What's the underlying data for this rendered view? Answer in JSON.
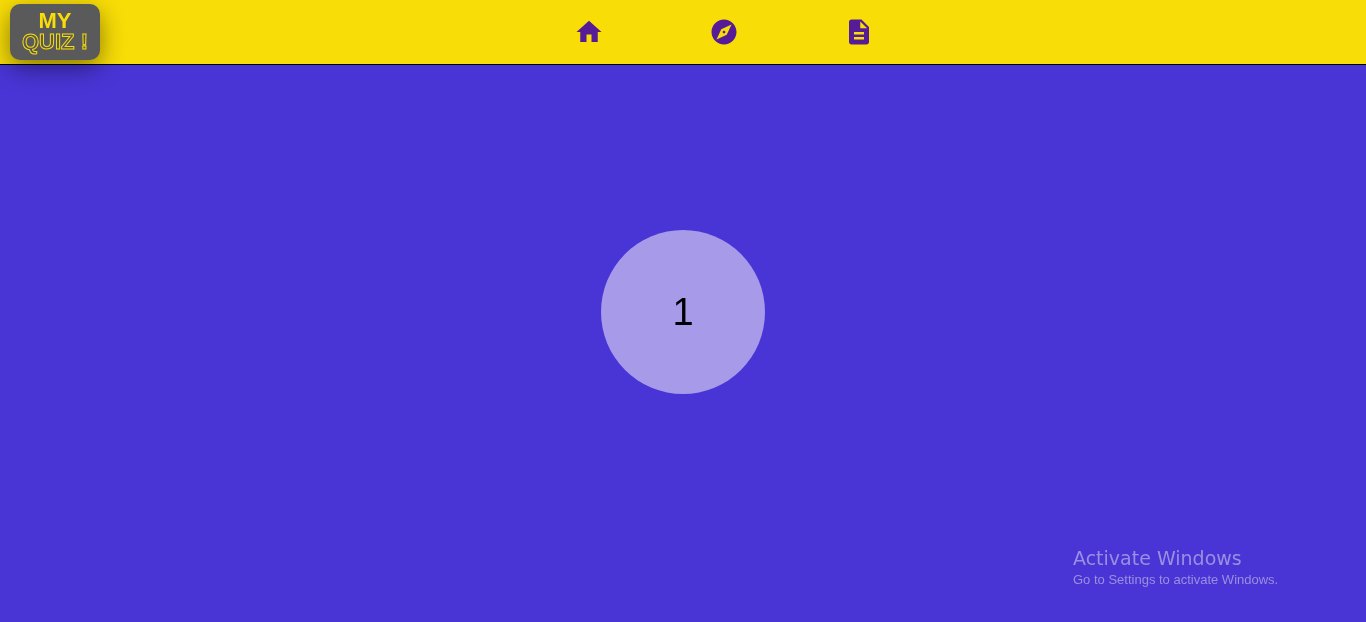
{
  "logo": {
    "line_1": "MY",
    "line_2": "QUIZ !"
  },
  "counter": {
    "value": "1"
  },
  "activation_notice": {
    "title": "Activate Windows",
    "message": "Go to Settings to activate Windows."
  }
}
